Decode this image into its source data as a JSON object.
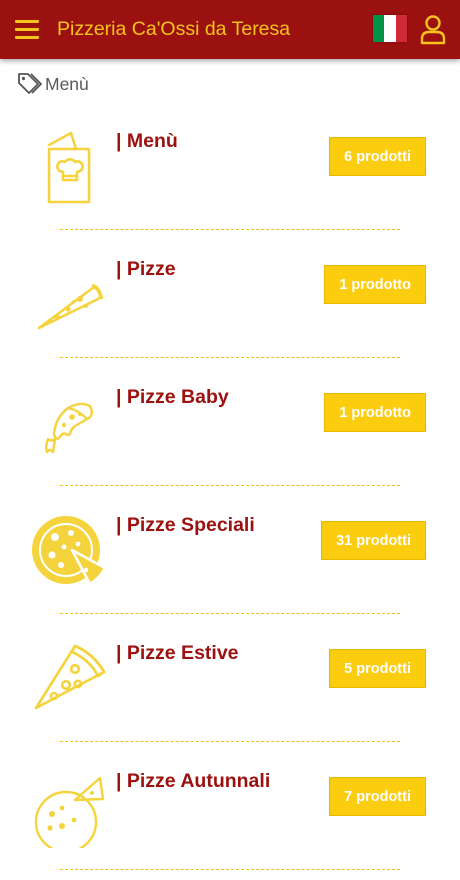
{
  "header": {
    "title": "Pizzeria Ca'Ossi da Teresa"
  },
  "colors": {
    "primary": "#9b1110",
    "accent": "#f6c31a",
    "badge": "#fccd0e"
  },
  "breadcrumb": {
    "icon": "tag-icon",
    "label": "Menù"
  },
  "categories": [
    {
      "title": "| Menù",
      "count": "6 prodotti",
      "icon": "menu-card-icon"
    },
    {
      "title": "| Pizze",
      "count": "1 prodotto",
      "icon": "pizza-slice-icon"
    },
    {
      "title": "| Pizze Baby",
      "count": "1 prodotto",
      "icon": "small-pizza-slice-icon"
    },
    {
      "title": "| Pizze Speciali",
      "count": "31 prodotti",
      "icon": "whole-pizza-icon"
    },
    {
      "title": "| Pizze Estive",
      "count": "5 prodotti",
      "icon": "pepperoni-slice-icon"
    },
    {
      "title": "| Pizze Autunnali",
      "count": "7 prodotti",
      "icon": "pizza-with-slice-icon"
    }
  ]
}
